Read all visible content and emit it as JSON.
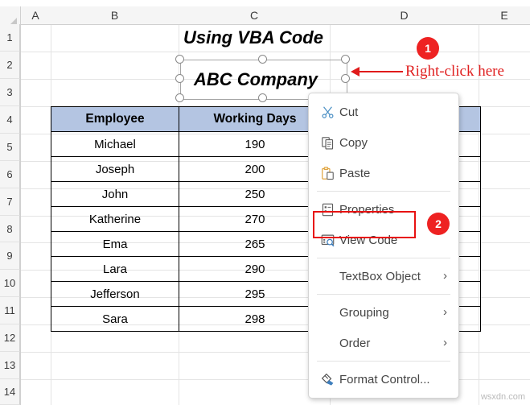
{
  "spreadsheet": {
    "columns": [
      "A",
      "B",
      "C",
      "D",
      "E"
    ],
    "rows": [
      "1",
      "2",
      "3",
      "4",
      "5",
      "6",
      "7",
      "8",
      "9",
      "10",
      "11",
      "12",
      "13",
      "14"
    ]
  },
  "titles": {
    "sheet_title": "Using VBA Code",
    "textbox_text": "ABC Company"
  },
  "table": {
    "headers": [
      "Employee",
      "Working Days",
      ""
    ],
    "rows": [
      {
        "employee": "Michael",
        "days": "190",
        "blank": ""
      },
      {
        "employee": "Joseph",
        "days": "200",
        "blank": ""
      },
      {
        "employee": "John",
        "days": "250",
        "blank": ""
      },
      {
        "employee": "Katherine",
        "days": "270",
        "blank": ""
      },
      {
        "employee": "Ema",
        "days": "265",
        "blank": ""
      },
      {
        "employee": "Lara",
        "days": "290",
        "blank": ""
      },
      {
        "employee": "Jefferson",
        "days": "295",
        "blank": ""
      },
      {
        "employee": "Sara",
        "days": "298",
        "blank": ""
      }
    ]
  },
  "context_menu": {
    "items": [
      {
        "label": "Cut",
        "icon": "scissors-icon",
        "submenu": false,
        "separator_after": false
      },
      {
        "label": "Copy",
        "icon": "copy-icon",
        "submenu": false,
        "separator_after": false
      },
      {
        "label": "Paste",
        "icon": "paste-icon",
        "submenu": false,
        "separator_after": true
      },
      {
        "label": "Properties",
        "icon": "properties-icon",
        "submenu": false,
        "separator_after": false
      },
      {
        "label": "View Code",
        "icon": "view-code-icon",
        "submenu": false,
        "separator_after": true
      },
      {
        "label": "TextBox Object",
        "icon": "none",
        "submenu": true,
        "separator_after": true
      },
      {
        "label": "Grouping",
        "icon": "none",
        "submenu": true,
        "separator_after": false
      },
      {
        "label": "Order",
        "icon": "none",
        "submenu": true,
        "separator_after": true
      },
      {
        "label": "Format Control...",
        "icon": "paint-bucket-icon",
        "submenu": false,
        "separator_after": false
      }
    ],
    "submenu_glyph": "›"
  },
  "annotations": {
    "step1_badge": "1",
    "step2_badge": "2",
    "callout_text": "Right-click here"
  },
  "watermark": "wsxdn.com",
  "colors": {
    "accent_red": "#ee2222",
    "header_fill": "#b4c5e2",
    "grid_line": "#e4e4e4",
    "header_strip": "#f5f5f5"
  }
}
